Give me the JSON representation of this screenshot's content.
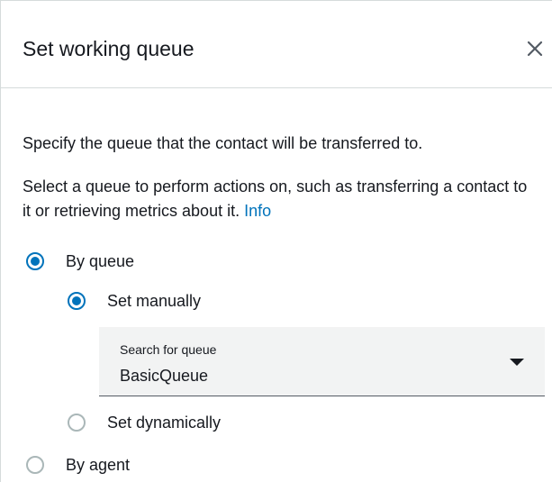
{
  "dialog": {
    "title": "Set working queue",
    "close_icon": "close-icon"
  },
  "content": {
    "description_1": "Specify the queue that the contact will be transferred to.",
    "description_2": "Select a queue to perform actions on, such as transferring a contact to it or retrieving metrics about it.",
    "info_link": "Info"
  },
  "options": {
    "by_queue": {
      "label": "By queue",
      "checked": true
    },
    "set_manually": {
      "label": "Set manually",
      "checked": true
    },
    "set_dynamically": {
      "label": "Set dynamically",
      "checked": false
    },
    "by_agent": {
      "label": "By agent",
      "checked": false
    }
  },
  "queue_select": {
    "label": "Search for queue",
    "value": "BasicQueue",
    "icon": "caret-down-icon"
  },
  "colors": {
    "accent": "#0073bb",
    "text": "#16191f",
    "border": "#d5dbdb",
    "select_bg": "#f2f3f3"
  }
}
